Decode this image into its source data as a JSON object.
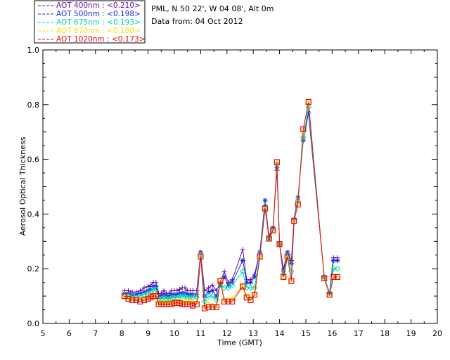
{
  "header": {
    "location": "PML, N 50 22', W 04 08', Alt 0m",
    "date_line": "Data from: 04 Oct 2012"
  },
  "legend": [
    {
      "label": "AOT  400nm : <0.210>",
      "color": "#6a0aa0"
    },
    {
      "label": "AOT  500nm : <0.198>",
      "color": "#1a2ae0"
    },
    {
      "label": "AOT  675nm : <0.193>",
      "color": "#00d8a8"
    },
    {
      "label": "AOT  870nm : <0.180>",
      "color": "#f0e000"
    },
    {
      "label": "AOT 1020nm : <0.173>",
      "color": "#e01010"
    }
  ],
  "chart_data": {
    "type": "line",
    "xlabel": "Time (GMT)",
    "ylabel": "Aerosol Optical Thickness",
    "xlim": [
      5,
      20
    ],
    "ylim": [
      0,
      1.0
    ],
    "xticks": [
      5,
      6,
      7,
      8,
      9,
      10,
      11,
      12,
      13,
      14,
      15,
      16,
      17,
      18,
      19,
      20
    ],
    "yticks": [
      0.0,
      0.2,
      0.4,
      0.6,
      0.8,
      1.0
    ],
    "ytick_labels": [
      "0.0",
      "0.2",
      "0.4",
      "0.6",
      "0.8",
      "1.0"
    ],
    "x": [
      8.1,
      8.25,
      8.4,
      8.55,
      8.7,
      8.85,
      9.0,
      9.1,
      9.2,
      9.3,
      9.4,
      9.5,
      9.6,
      9.7,
      9.8,
      9.9,
      10.0,
      10.1,
      10.2,
      10.3,
      10.4,
      10.5,
      10.6,
      10.7,
      10.85,
      11.0,
      11.15,
      11.3,
      11.45,
      11.6,
      11.75,
      11.9,
      12.05,
      12.2,
      12.6,
      12.75,
      12.9,
      13.05,
      13.25,
      13.45,
      13.6,
      13.75,
      13.9,
      14.0,
      14.15,
      14.3,
      14.45,
      14.55,
      14.7,
      14.9,
      15.1,
      15.7,
      15.9,
      16.05,
      16.2
    ],
    "series": [
      {
        "name": "AOT  400nm",
        "color": "#6a0aa0",
        "marker": "plus",
        "values": [
          0.12,
          0.12,
          0.115,
          0.115,
          0.12,
          0.13,
          0.135,
          0.14,
          0.15,
          0.15,
          0.11,
          0.11,
          0.12,
          0.11,
          0.11,
          0.12,
          0.12,
          0.12,
          0.125,
          0.13,
          0.13,
          0.12,
          0.12,
          0.12,
          0.12,
          0.26,
          0.12,
          0.13,
          0.14,
          0.12,
          0.15,
          0.19,
          0.15,
          0.16,
          0.27,
          0.16,
          0.16,
          0.18,
          0.26,
          0.43,
          0.32,
          0.35,
          0.56,
          0.29,
          0.2,
          0.26,
          0.23,
          0.38,
          0.46,
          0.67,
          0.77,
          0.17,
          0.11,
          0.24,
          0.24
        ]
      },
      {
        "name": "AOT  500nm",
        "color": "#1a2ae0",
        "marker": "asterisk",
        "values": [
          0.11,
          0.11,
          0.105,
          0.105,
          0.11,
          0.115,
          0.12,
          0.125,
          0.135,
          0.135,
          0.1,
          0.1,
          0.105,
          0.1,
          0.1,
          0.105,
          0.105,
          0.105,
          0.11,
          0.11,
          0.11,
          0.105,
          0.105,
          0.105,
          0.105,
          0.26,
          0.1,
          0.115,
          0.12,
          0.1,
          0.14,
          0.17,
          0.14,
          0.15,
          0.23,
          0.15,
          0.15,
          0.17,
          0.26,
          0.45,
          0.31,
          0.35,
          0.57,
          0.29,
          0.19,
          0.26,
          0.22,
          0.38,
          0.46,
          0.67,
          0.77,
          0.17,
          0.11,
          0.23,
          0.23
        ]
      },
      {
        "name": "AOT  675nm",
        "color": "#00d8a8",
        "marker": "diamond",
        "values": [
          0.105,
          0.1,
          0.1,
          0.095,
          0.1,
          0.105,
          0.11,
          0.115,
          0.125,
          0.125,
          0.09,
          0.09,
          0.095,
          0.09,
          0.09,
          0.095,
          0.095,
          0.095,
          0.1,
          0.1,
          0.1,
          0.095,
          0.095,
          0.095,
          0.095,
          0.25,
          0.08,
          0.1,
          0.1,
          0.085,
          0.14,
          0.13,
          0.13,
          0.14,
          0.19,
          0.13,
          0.13,
          0.13,
          0.25,
          0.43,
          0.31,
          0.34,
          0.58,
          0.29,
          0.18,
          0.25,
          0.19,
          0.37,
          0.45,
          0.68,
          0.79,
          0.17,
          0.11,
          0.2,
          0.2
        ]
      },
      {
        "name": "AOT  870nm",
        "color": "#f0e000",
        "marker": "triangle",
        "values": [
          0.1,
          0.095,
          0.09,
          0.09,
          0.09,
          0.09,
          0.095,
          0.1,
          0.105,
          0.105,
          0.075,
          0.075,
          0.08,
          0.075,
          0.075,
          0.08,
          0.08,
          0.08,
          0.08,
          0.08,
          0.08,
          0.08,
          0.08,
          0.08,
          0.08,
          0.25,
          0.06,
          0.07,
          0.065,
          0.065,
          0.16,
          0.085,
          0.085,
          0.09,
          0.14,
          0.1,
          0.09,
          0.11,
          0.24,
          0.42,
          0.31,
          0.34,
          0.59,
          0.29,
          0.17,
          0.24,
          0.16,
          0.375,
          0.44,
          0.7,
          0.81,
          0.165,
          0.105,
          0.17,
          0.17
        ]
      },
      {
        "name": "AOT 1020nm",
        "color": "#e01010",
        "marker": "square",
        "values": [
          0.1,
          0.09,
          0.085,
          0.085,
          0.08,
          0.085,
          0.09,
          0.095,
          0.1,
          0.1,
          0.07,
          0.07,
          0.07,
          0.07,
          0.07,
          0.07,
          0.075,
          0.075,
          0.075,
          0.07,
          0.07,
          0.07,
          0.07,
          0.065,
          0.07,
          0.245,
          0.055,
          0.06,
          0.06,
          0.06,
          0.155,
          0.08,
          0.08,
          0.08,
          0.135,
          0.095,
          0.085,
          0.105,
          0.245,
          0.42,
          0.31,
          0.34,
          0.59,
          0.29,
          0.17,
          0.245,
          0.155,
          0.375,
          0.435,
          0.71,
          0.81,
          0.165,
          0.105,
          0.17,
          0.17
        ]
      }
    ]
  }
}
